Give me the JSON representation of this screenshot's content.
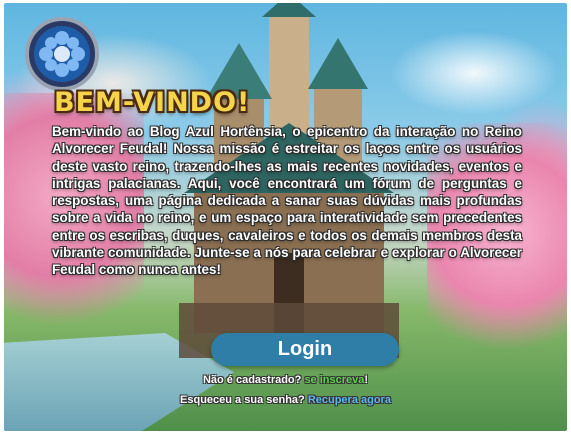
{
  "header": {
    "emblem": "blue-flower-shield-emblem",
    "title": "BEM-VINDO!"
  },
  "intro": {
    "text": "Bem-vindo ao Blog Azul Hortênsia, o epicentro da interação no Reino Alvorecer Feudal! Nossa missão é estreitar os laços entre os usuários deste vasto reino, trazendo-lhes as mais recentes novidades, eventos e intrigas palacianas. Aqui, você encontrará um fórum de perguntas e respostas, uma página dedicada a sanar suas dúvidas mais profundas sobre a vida no reino, e um espaço para interatividade sem precedentes entre os escribas, duques, cavaleiros e todos os demais membros desta vibrante comunidade. Junte-se a nós para celebrar e explorar o Alvorecer Feudal como nunca antes!"
  },
  "login": {
    "button_label": "Login"
  },
  "signup": {
    "prompt": "Não é cadastrado?",
    "link_label": "se inscreva",
    "suffix": "!"
  },
  "recover": {
    "prompt": "Esqueceu a sua senha?",
    "link_label": "Recupera agora"
  },
  "colors": {
    "title": "#f5d34a",
    "button": "#2f7ea7",
    "signup_link": "#5fd24f",
    "recover_link": "#5fb5ec"
  }
}
